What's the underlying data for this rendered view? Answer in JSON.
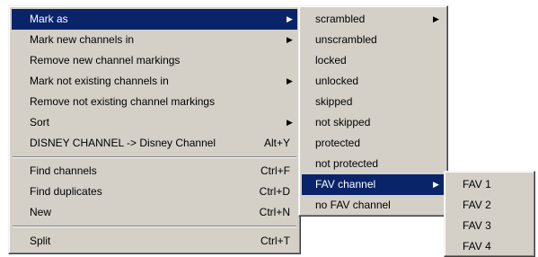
{
  "main_menu": {
    "items": [
      {
        "label": "Mark as",
        "shortcut": "",
        "submenu": true,
        "selected": true
      },
      {
        "label": "Mark new channels in",
        "shortcut": "",
        "submenu": true,
        "selected": false
      },
      {
        "label": "Remove new channel markings",
        "shortcut": "",
        "submenu": false,
        "selected": false
      },
      {
        "label": "Mark not existing channels in",
        "shortcut": "",
        "submenu": true,
        "selected": false
      },
      {
        "label": "Remove not existing channel markings",
        "shortcut": "",
        "submenu": false,
        "selected": false
      },
      {
        "label": "Sort",
        "shortcut": "",
        "submenu": true,
        "selected": false
      },
      {
        "label": "DISNEY CHANNEL -> Disney Channel",
        "shortcut": "Alt+Y",
        "submenu": false,
        "selected": false
      },
      {
        "label": "Find channels",
        "shortcut": "Ctrl+F",
        "submenu": false,
        "selected": false
      },
      {
        "label": "Find duplicates",
        "shortcut": "Ctrl+D",
        "submenu": false,
        "selected": false
      },
      {
        "label": "New",
        "shortcut": "Ctrl+N",
        "submenu": false,
        "selected": false
      },
      {
        "label": "Split",
        "shortcut": "Ctrl+T",
        "submenu": false,
        "selected": false
      }
    ]
  },
  "mark_as_submenu": {
    "items": [
      {
        "label": "scrambled",
        "submenu": true,
        "selected": false
      },
      {
        "label": "unscrambled",
        "submenu": false,
        "selected": false
      },
      {
        "label": "locked",
        "submenu": false,
        "selected": false
      },
      {
        "label": "unlocked",
        "submenu": false,
        "selected": false
      },
      {
        "label": "skipped",
        "submenu": false,
        "selected": false
      },
      {
        "label": "not skipped",
        "submenu": false,
        "selected": false
      },
      {
        "label": "protected",
        "submenu": false,
        "selected": false
      },
      {
        "label": "not protected",
        "submenu": false,
        "selected": false
      },
      {
        "label": "FAV channel",
        "submenu": true,
        "selected": true
      },
      {
        "label": "no FAV channel",
        "submenu": false,
        "selected": false
      }
    ]
  },
  "fav_submenu": {
    "items": [
      {
        "label": "FAV 1"
      },
      {
        "label": "FAV 2"
      },
      {
        "label": "FAV 3"
      },
      {
        "label": "FAV 4"
      }
    ]
  },
  "icons": {
    "submenu_arrow": "▶"
  },
  "colors": {
    "selection": "#0a246a",
    "menu_bg": "#d4d0c8"
  }
}
